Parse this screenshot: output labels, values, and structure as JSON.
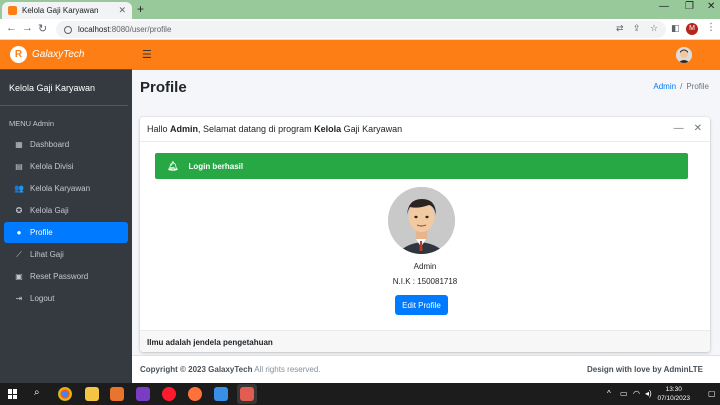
{
  "browser": {
    "tab_title": "Kelola Gaji Karyawan",
    "url_host": "localhost",
    "url_rest": ":8080/user/profile",
    "profile_initial": "M"
  },
  "app": {
    "brand": "GalaxyTech",
    "brand_logo_letter": "R",
    "panel_title": "Kelola Gaji Karyawan",
    "menu_header": "MENU Admin",
    "menu": [
      {
        "label": "Dashboard",
        "icon": "table-grid-icon"
      },
      {
        "label": "Kelola Divisi",
        "icon": "clipboard-icon"
      },
      {
        "label": "Kelola Karyawan",
        "icon": "users-icon"
      },
      {
        "label": "Kelola Gaji",
        "icon": "award-icon"
      },
      {
        "label": "Profile",
        "icon": "user-icon",
        "active": true
      },
      {
        "label": "Lihat Gaji",
        "icon": "chart-line-icon"
      },
      {
        "label": "Reset Password",
        "icon": "lock-icon"
      },
      {
        "label": "Logout",
        "icon": "sign-out-icon"
      }
    ]
  },
  "page": {
    "title": "Profile",
    "breadcrumb": {
      "home": "Admin",
      "current": "Profile"
    }
  },
  "card": {
    "greeting_pre": "Hallo ",
    "greeting_user": "Admin",
    "greeting_mid": ", Selamat datang di program ",
    "greeting_bold": "Kelola",
    "greeting_post": " Gaji Karyawan",
    "alert": "Login berhasil",
    "user_name": "Admin",
    "user_nik": "N.I.K : 150081718",
    "edit_button": "Edit Profile",
    "footer": "Ilmu adalah jendela pengetahuan"
  },
  "footer": {
    "copyright_pre": "Copyright © 2023 ",
    "copyright_brand": "GalaxyTech",
    "copyright_post": " All rights reserved.",
    "credit": "Design with love by AdminLTE"
  },
  "taskbar": {
    "time": "13:30",
    "date": "07/10/2023"
  },
  "colors": {
    "accent": "#fd7e14",
    "sidebar": "#343a40",
    "primary": "#007bff",
    "success": "#28a745"
  }
}
